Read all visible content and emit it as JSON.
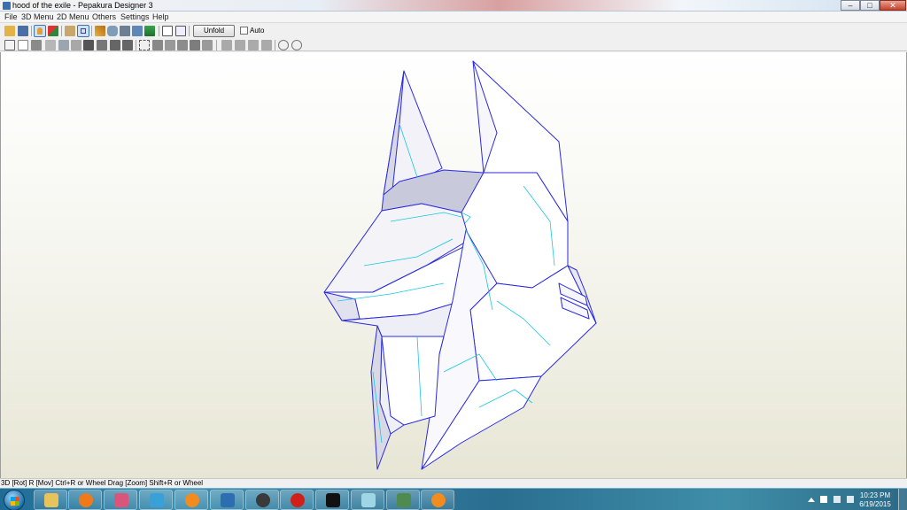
{
  "window": {
    "title": "hood of the exile - Pepakura Designer 3",
    "minimize_glyph": "–",
    "maximize_glyph": "□",
    "close_glyph": "✕"
  },
  "menu": [
    "File",
    "3D Menu",
    "2D Menu",
    "Others",
    "Settings",
    "Help"
  ],
  "toolbar": {
    "unfold_label": "Unfold",
    "auto_label": "Auto",
    "auto_checked": false,
    "row1_icons": [
      "open-icon",
      "save-icon",
      "texture-toggle-icon",
      "solid-toggle-icon",
      "rotate-view-icon",
      "select-view-icon",
      "pencil-icon",
      "cylinder-icon",
      "anchor-icon",
      "pages-icon",
      "flag-icon",
      "layout-icon",
      "paper-icon"
    ],
    "row2_icons": [
      "select-tool-icon",
      "edge-tool-icon",
      "grid-tool-icon",
      "join-icon",
      "split-icon",
      "flap-icon",
      "rotate-left-icon",
      "rotate-right-icon",
      "undo-icon",
      "redo-icon",
      "move-icon",
      "scale-icon",
      "text-icon",
      "bitmap-icon",
      "print-icon",
      "align-left-icon",
      "align-center-icon",
      "align-right-icon",
      "align-top-icon",
      "zoom-in-icon",
      "zoom-out-icon"
    ]
  },
  "status": {
    "hint": "3D [Rot] R [Mov] Ctrl+R or Wheel Drag [Zoom] Shift+R or Wheel"
  },
  "taskbar": {
    "apps": [
      "explorer-icon",
      "media-player-icon",
      "paint-icon",
      "blender-icon",
      "box-app-icon",
      "vmware-icon",
      "settings-app-icon",
      "opera-icon",
      "cmd-icon",
      "glass-app-icon",
      "monitor-icon",
      "blender-icon"
    ],
    "time": "10:23 PM",
    "date": "6/19/2015"
  },
  "colors": {
    "accent": "#3b73b9",
    "mesh_edge": "#2a2ae0",
    "mesh_fold": "#18c8e0"
  }
}
